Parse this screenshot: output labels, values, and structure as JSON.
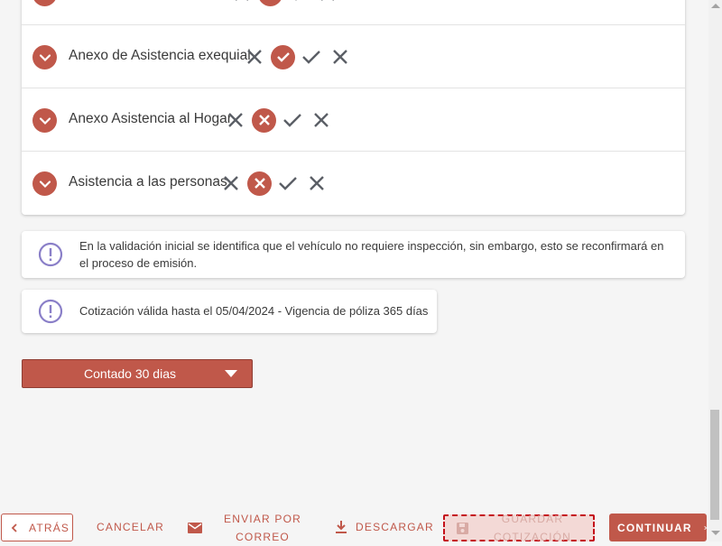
{
  "coverages": [
    {
      "name": "",
      "marks": [
        "x",
        "x-circle",
        "check",
        "x"
      ]
    },
    {
      "name": "Anexo de Asistencia exequial",
      "marks": [
        "x",
        "check-circle",
        "check",
        "x"
      ]
    },
    {
      "name": "Anexo Asistencia al Hogar",
      "marks": [
        "x",
        "x-circle",
        "check",
        "x"
      ]
    },
    {
      "name": "Asistencia a las personas",
      "marks": [
        "x",
        "x-circle",
        "check",
        "x"
      ]
    }
  ],
  "notices": {
    "inspection": "En la validación inicial se identifica que el vehículo no requiere inspección, sin embargo, esto se reconfirmará en el proceso de emisión.",
    "validity": "Cotización válida hasta el 05/04/2024 - Vigencia de póliza 365 días"
  },
  "payment_select": {
    "selected": "Contado 30 dias"
  },
  "footer": {
    "back": "ATRÁS",
    "cancel": "CANCELAR",
    "email_line1": "ENVIAR POR",
    "email_line2": "CORREO",
    "download": "DESCARGAR",
    "save_line1": "GUARDAR",
    "save_line2": "COTIZACIÓN",
    "continue": "CONTINUAR"
  },
  "colors": {
    "accent": "#c0584a",
    "info": "#8a7fc8",
    "mark": "#5b5f66"
  }
}
